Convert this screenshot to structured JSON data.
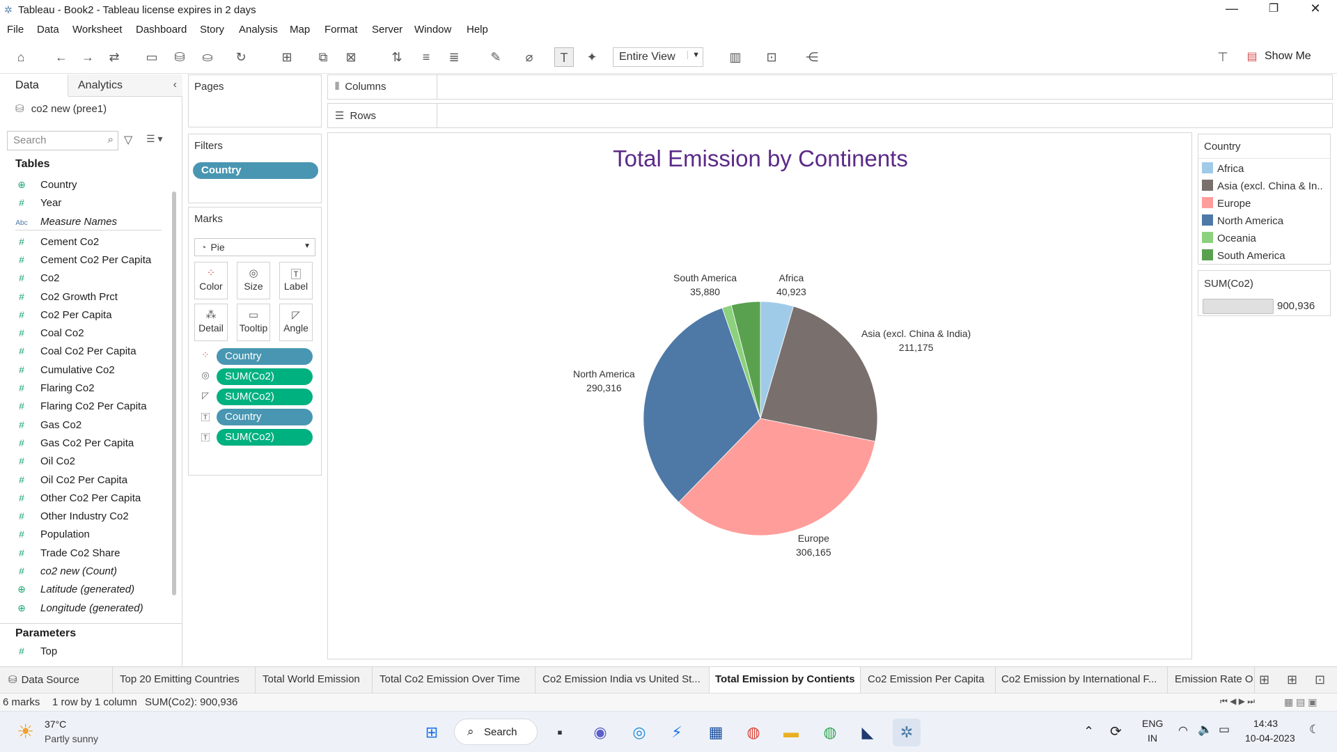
{
  "window": {
    "title": "Tableau - Book2 - Tableau license expires in 2 days"
  },
  "menu": [
    "File",
    "Data",
    "Worksheet",
    "Dashboard",
    "Story",
    "Analysis",
    "Map",
    "Format",
    "Server",
    "Window",
    "Help"
  ],
  "toolbar": {
    "fit": "Entire View",
    "show_me": "Show Me"
  },
  "data_pane": {
    "tab_data": "Data",
    "tab_analytics": "Analytics",
    "source": "co2 new (pree1)",
    "search_placeholder": "Search",
    "tables_header": "Tables",
    "fields": [
      {
        "name": "Country",
        "type": "globe",
        "italic": false
      },
      {
        "name": "Year",
        "type": "num",
        "italic": false
      },
      {
        "name": "Measure Names",
        "type": "abc",
        "italic": true
      },
      {
        "name": "Cement Co2",
        "type": "num",
        "italic": false
      },
      {
        "name": "Cement Co2 Per Capita",
        "type": "num",
        "italic": false
      },
      {
        "name": "Co2",
        "type": "num",
        "italic": false
      },
      {
        "name": "Co2 Growth Prct",
        "type": "num",
        "italic": false
      },
      {
        "name": "Co2 Per Capita",
        "type": "num",
        "italic": false
      },
      {
        "name": "Coal Co2",
        "type": "num",
        "italic": false
      },
      {
        "name": "Coal Co2 Per Capita",
        "type": "num",
        "italic": false
      },
      {
        "name": "Cumulative Co2",
        "type": "num",
        "italic": false
      },
      {
        "name": "Flaring Co2",
        "type": "num",
        "italic": false
      },
      {
        "name": "Flaring Co2 Per Capita",
        "type": "num",
        "italic": false
      },
      {
        "name": "Gas Co2",
        "type": "num",
        "italic": false
      },
      {
        "name": "Gas Co2 Per Capita",
        "type": "num",
        "italic": false
      },
      {
        "name": "Oil Co2",
        "type": "num",
        "italic": false
      },
      {
        "name": "Oil Co2 Per Capita",
        "type": "num",
        "italic": false
      },
      {
        "name": "Other Co2 Per Capita",
        "type": "num",
        "italic": false
      },
      {
        "name": "Other Industry Co2",
        "type": "num",
        "italic": false
      },
      {
        "name": "Population",
        "type": "num",
        "italic": false
      },
      {
        "name": "Trade Co2 Share",
        "type": "num",
        "italic": false
      },
      {
        "name": "co2 new (Count)",
        "type": "num",
        "italic": true
      },
      {
        "name": "Latitude (generated)",
        "type": "globe",
        "italic": true
      },
      {
        "name": "Longitude (generated)",
        "type": "globe",
        "italic": true
      }
    ],
    "parameters_header": "Parameters",
    "parameters": [
      {
        "name": "Top",
        "type": "num"
      }
    ]
  },
  "shelves": {
    "pages": "Pages",
    "filters": "Filters",
    "filter_pill": "Country",
    "columns": "Columns",
    "rows": "Rows",
    "marks": "Marks",
    "mark_type": "Pie",
    "mark_buttons": [
      "Color",
      "Size",
      "Label",
      "Detail",
      "Tooltip",
      "Angle"
    ],
    "mark_pills": [
      {
        "icon": "color",
        "label": "Country",
        "kind": "dim"
      },
      {
        "icon": "size",
        "label": "SUM(Co2)",
        "kind": "meas"
      },
      {
        "icon": "angle",
        "label": "SUM(Co2)",
        "kind": "meas"
      },
      {
        "icon": "label",
        "label": "Country",
        "kind": "dim"
      },
      {
        "icon": "label",
        "label": "SUM(Co2)",
        "kind": "meas"
      }
    ]
  },
  "chart_data": {
    "type": "pie",
    "title": "Total Emission by Continents",
    "categories": [
      "Africa",
      "Asia (excl. China & India)",
      "Europe",
      "North America",
      "Oceania",
      "South America"
    ],
    "values": [
      40923,
      211175,
      306165,
      290316,
      11557,
      35880
    ],
    "labels": [
      {
        "name": "Africa",
        "value": "40,923"
      },
      {
        "name": "Asia (excl. China & India)",
        "value": "211,175"
      },
      {
        "name": "Europe",
        "value": "306,165"
      },
      {
        "name": "North America",
        "value": "290,316"
      },
      {
        "name": "South America",
        "value": "35,880"
      }
    ],
    "colors": [
      "#a0cbe8",
      "#79706e",
      "#ff9d9a",
      "#4e79a7",
      "#8cd17d",
      "#59a14f"
    ]
  },
  "legend": {
    "title": "Country",
    "items": [
      "Africa",
      "Asia (excl. China & In..",
      "Europe",
      "North America",
      "Oceania",
      "South America"
    ],
    "size_title": "SUM(Co2)",
    "size_value": "900,936"
  },
  "sheet_tabs": [
    "Data Source",
    "Top 20 Emitting Countries",
    "Total World Emission",
    "Total Co2 Emission Over Time",
    "Co2 Emission India vs United St...",
    "Total Emission by Contients",
    "Co2 Emission Per Capita",
    "Co2 Emission by International F...",
    "Emission Rate O"
  ],
  "active_tab": 5,
  "status": {
    "marks": "6 marks",
    "rows": "1 row by 1 column",
    "sum": "SUM(Co2): 900,936"
  },
  "taskbar": {
    "temp": "37°C",
    "weather": "Partly sunny",
    "search": "Search",
    "lang": "ENG",
    "region": "IN",
    "time": "14:43",
    "date": "10-04-2023"
  }
}
